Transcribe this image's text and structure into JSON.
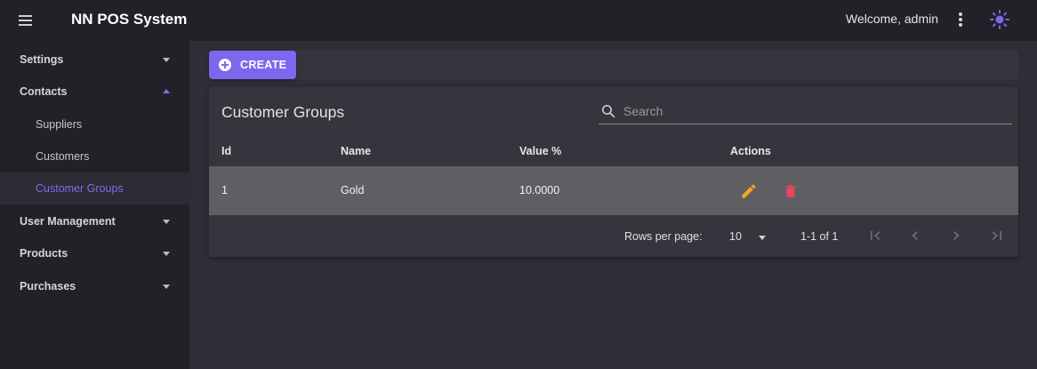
{
  "app": {
    "title": "NN POS System",
    "welcome": "Welcome, admin"
  },
  "icons": {
    "menu": "menu-icon",
    "more": "more-vert-icon",
    "theme": "brightness-icon",
    "search": "search-icon",
    "edit": "pencil-icon",
    "delete": "trash-icon"
  },
  "colors": {
    "accent": "#7b68ee",
    "edit": "#f5a623",
    "delete": "#e8475b"
  },
  "sidebar": {
    "items": [
      {
        "label": "Settings"
      },
      {
        "label": "Contacts"
      },
      {
        "label": "Suppliers"
      },
      {
        "label": "Customers"
      },
      {
        "label": "Customer Groups"
      },
      {
        "label": "User Management"
      },
      {
        "label": "Products"
      },
      {
        "label": "Purchases"
      }
    ]
  },
  "toolbar": {
    "create_label": "CREATE"
  },
  "table": {
    "title": "Customer Groups",
    "search_placeholder": "Search",
    "search_value": "",
    "headers": {
      "id": "Id",
      "name": "Name",
      "value": "Value %",
      "actions": "Actions"
    },
    "rows": [
      {
        "id": "1",
        "name": "Gold",
        "value": "10.0000"
      }
    ]
  },
  "pagination": {
    "rows_per_page_label": "Rows per page:",
    "rows_per_page": "10",
    "range": "1-1 of 1"
  }
}
